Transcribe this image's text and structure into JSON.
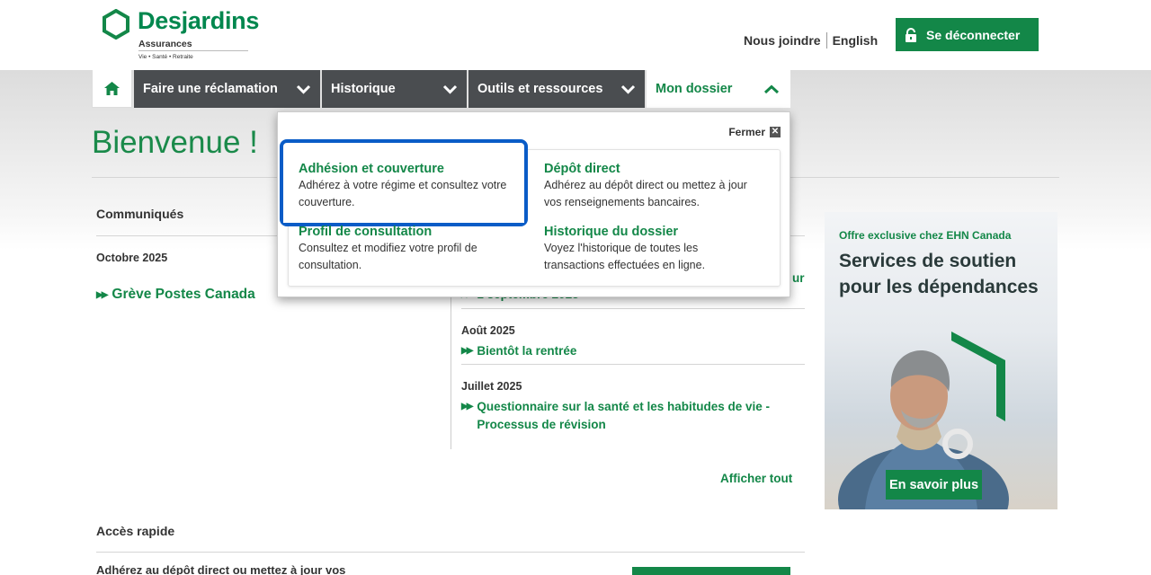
{
  "header": {
    "logo_name": "Desjardins",
    "logo_sub": "Assurances",
    "logo_tagline": "Vie • Santé • Retraite",
    "contact_label": "Nous joindre",
    "language_label": "English",
    "logout_label": "Se déconnecter"
  },
  "nav": {
    "items": [
      {
        "label": "Faire une réclamation"
      },
      {
        "label": "Historique"
      },
      {
        "label": "Outils et ressources"
      },
      {
        "label": "Mon dossier"
      }
    ]
  },
  "page": {
    "title": "Bienvenue !"
  },
  "communiques": {
    "title": "Communiqués",
    "left_month": "Octobre 2025",
    "left_link": "Grève Postes Canada",
    "right_partial_link": "1 septembre 2025",
    "right_partial_suffix": "ur",
    "entries": [
      {
        "month": "Août 2025",
        "link": "Bientôt la rentrée"
      },
      {
        "month": "Juillet 2025",
        "link": "Questionnaire sur la santé et les habitudes de vie - Processus de révision"
      }
    ],
    "show_all": "Afficher tout"
  },
  "quick_access": {
    "title": "Accès rapide",
    "text": "Adhérez au dépôt direct ou mettez à jour vos"
  },
  "ad": {
    "kicker": "Offre exclusive chez EHN Canada",
    "title": "Services de soutien pour les dépendances",
    "button": "En savoir plus"
  },
  "dropdown": {
    "close_label": "Fermer",
    "items": [
      {
        "title": "Adhésion et couverture",
        "desc": "Adhérez à votre régime et consultez votre couverture."
      },
      {
        "title": "Dépôt direct",
        "desc": "Adhérez au dépôt direct ou mettez à jour vos renseignements bancaires."
      },
      {
        "title": "Profil de consultation",
        "desc": "Consultez et modifiez votre profil de consultation."
      },
      {
        "title": "Historique du dossier",
        "desc": "Voyez l'historique de toutes les transactions effectuées en ligne."
      }
    ]
  },
  "colors": {
    "brand_green": "#138748",
    "nav_dark": "#4a4d50",
    "highlight_blue": "#0a5cc7"
  }
}
